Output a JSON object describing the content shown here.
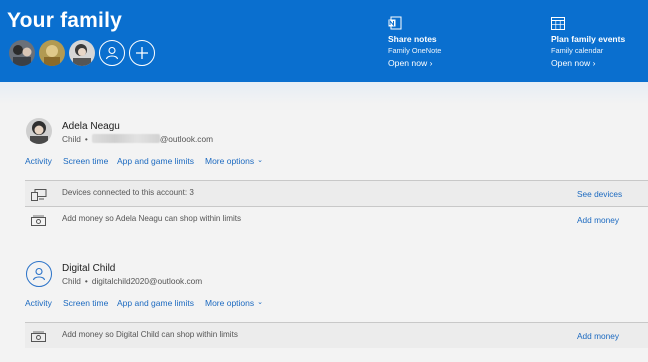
{
  "header": {
    "title": "Your family",
    "avatars": [
      {
        "name": "family-member-photo-1"
      },
      {
        "name": "family-member-photo-2"
      },
      {
        "name": "family-member-photo-3"
      },
      {
        "name": "add-person-icon"
      },
      {
        "name": "add-member-icon"
      }
    ],
    "promos": [
      {
        "icon": "onenote-icon",
        "title": "Share notes",
        "subtitle": "Family OneNote",
        "link": "Open now ›"
      },
      {
        "icon": "calendar-icon",
        "title": "Plan family events",
        "subtitle": "Family calendar",
        "link": "Open now ›"
      }
    ]
  },
  "members": [
    {
      "name": "Adela Neagu",
      "role": "Child",
      "email": "@outlook.com",
      "email_redacted": true,
      "links": [
        "Activity",
        "Screen time",
        "App and game limits",
        "More options"
      ],
      "rows": [
        {
          "icon": "devices-icon",
          "text": "Devices connected to this account: 3",
          "action": "See devices"
        },
        {
          "icon": "money-icon",
          "text": "Add money so Adela Neagu can shop within limits",
          "action": "Add money"
        }
      ]
    },
    {
      "name": "Digital Child",
      "role": "Child",
      "email": "digitalchild2020@outlook.com",
      "links": [
        "Activity",
        "Screen time",
        "App and game limits",
        "More options"
      ],
      "rows": [
        {
          "icon": "money-icon",
          "text": "Add money so Digital Child can shop within limits",
          "action": "Add money"
        }
      ]
    }
  ],
  "colors": {
    "header_bg": "#0a6fcf",
    "link": "#1c6ac0",
    "background": "#f3f3f3"
  }
}
